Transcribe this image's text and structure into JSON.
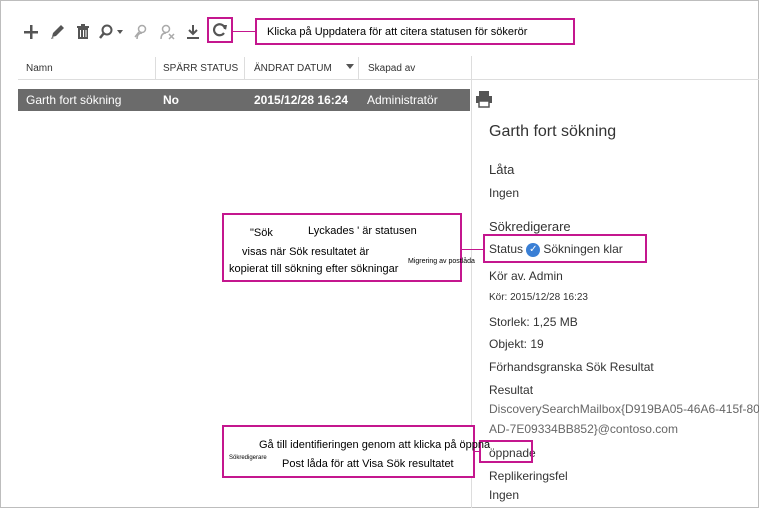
{
  "toolbar": {
    "icons": [
      "plus-icon",
      "pencil-icon",
      "trash-icon",
      "search-dropdown-icon",
      "person-search-icon",
      "person-remove-icon",
      "download-icon",
      "refresh-icon"
    ]
  },
  "callouts": {
    "top": "Klicka på Uppdatera för att citera statusen för sökerör",
    "middle_line1": "\"Sök",
    "middle_line1b": "Lyckades ' är statusen",
    "middle_line2": "visas när Sök resultatet är",
    "middle_line3": "kopierat till sökning efter sökningar",
    "middle_tail": "Migrering av postlåda",
    "bottom_line1": "Gå till identifieringen genom att klicka på öppna",
    "bottom_small": "Sökredigerare",
    "bottom_line2": "Post låda för att Visa Sök resultatet"
  },
  "table": {
    "headers": [
      "Namn",
      "SPÄRR STATUS",
      "ÄNDRAT DATUM",
      "Skapad av"
    ],
    "rows": [
      {
        "name": "Garth fort sökning",
        "hold": "No",
        "date": "2015/12/28 16:24",
        "creator": "Administratör"
      }
    ]
  },
  "details": {
    "title": "Garth fort sökning",
    "lata_label": "Låta",
    "lata_value": "Ingen",
    "sokredigerare": "Sökredigerare",
    "status_label": "Status",
    "status_value": "Sökningen klar",
    "run_by": "Kör av. Admin",
    "run_at": "Kör: 2015/12/28 16:23",
    "size": "Storlek: 1,25 MB",
    "items": "Objekt: 19",
    "preview": "Förhandsgranska Sök Resultat",
    "result_label": "Resultat",
    "result_line1": "DiscoverySearchMailbox{D919BA05-46A6-415f-80",
    "result_line2": "AD-7E09334BB852}@contoso.com",
    "opened": "öppnade",
    "replication_label": "Replikeringsfel",
    "replication_value": "Ingen"
  },
  "colors": {
    "highlight": "#c4168e",
    "selected_row": "#6b6b6b",
    "status_check": "#3a7fd5"
  }
}
